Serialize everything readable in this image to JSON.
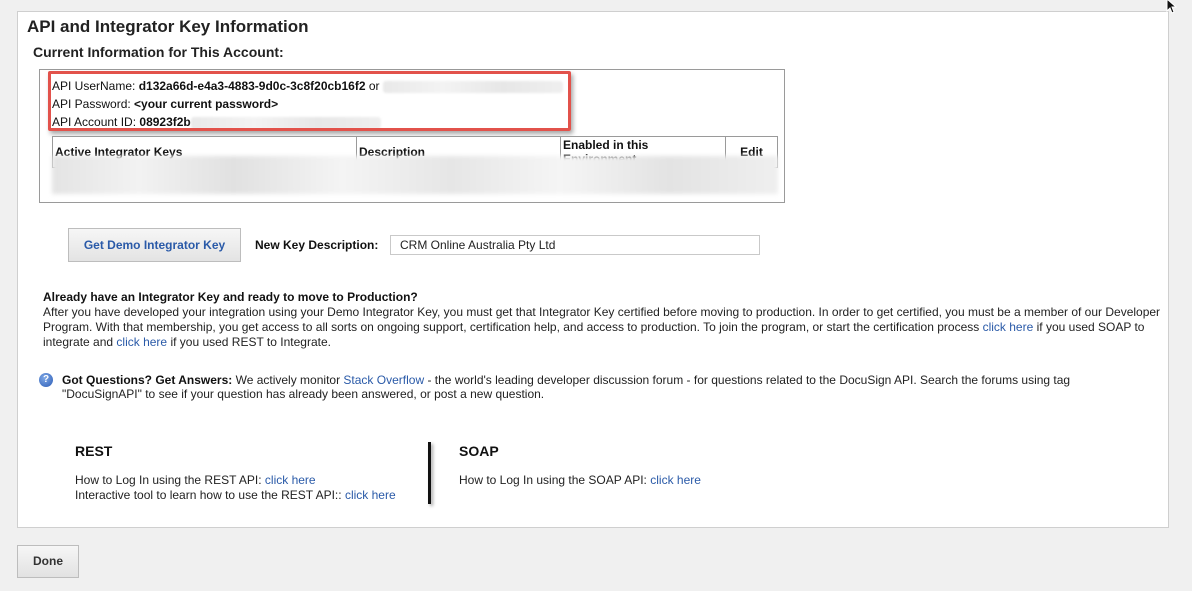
{
  "page": {
    "title": "API and Integrator Key Information",
    "subtitle": "Current Information for This Account:"
  },
  "credentials": {
    "username_label": "API UserName:",
    "username_value": "d132a66d-e4a3-4883-9d0c-3c8f20cb16f2",
    "username_or": "or",
    "password_label": "API Password:",
    "password_value": "<your current password>",
    "account_label": "API Account ID:",
    "account_value": "08923f2b"
  },
  "keys_table": {
    "headers": [
      "Active Integrator Keys",
      "Description",
      "Enabled in this Environment",
      "Edit"
    ]
  },
  "new_key": {
    "button_label": "Get Demo Integrator Key",
    "description_label": "New Key Description:",
    "description_value": "CRM Online Australia Pty Ltd"
  },
  "production": {
    "heading": "Already have an Integrator Key and ready to move to Production?",
    "text_1": "After you have developed your integration using your Demo Integrator Key, you must get that Integrator Key certified before moving to production. In order to get certified, you must be a member of our Developer Program. With that membership, you get access to all sorts on ongoing support, certification help, and access to production. To join the program, or start the certification process",
    "link_1": "click here",
    "text_2": "if you used SOAP to integrate and",
    "link_2": "click here",
    "text_3": "if you used REST to Integrate."
  },
  "questions": {
    "icon": "help-icon",
    "heading": "Got Questions? Get Answers:",
    "text_1": "We actively monitor",
    "link": "Stack Overflow",
    "text_2": "- the world's leading developer discussion forum - for questions related to the DocuSign API. Search the forums using tag \"DocuSignAPI\" to see if your question has already been answered, or post a new question."
  },
  "rest": {
    "heading": "REST",
    "line_1_text": "How to Log In using the REST API:",
    "line_1_link": "click here",
    "line_2_text": "Interactive tool to learn how to use the REST API::",
    "line_2_link": "click here"
  },
  "soap": {
    "heading": "SOAP",
    "line_1_text": "How to Log In using the SOAP API:",
    "line_1_link": "click here"
  },
  "footer": {
    "done_label": "Done"
  },
  "colors": {
    "link": "#2a5aa8",
    "highlight": "#e2524b",
    "panel_bg": "#ffffff",
    "page_bg": "#f0f0f0"
  }
}
